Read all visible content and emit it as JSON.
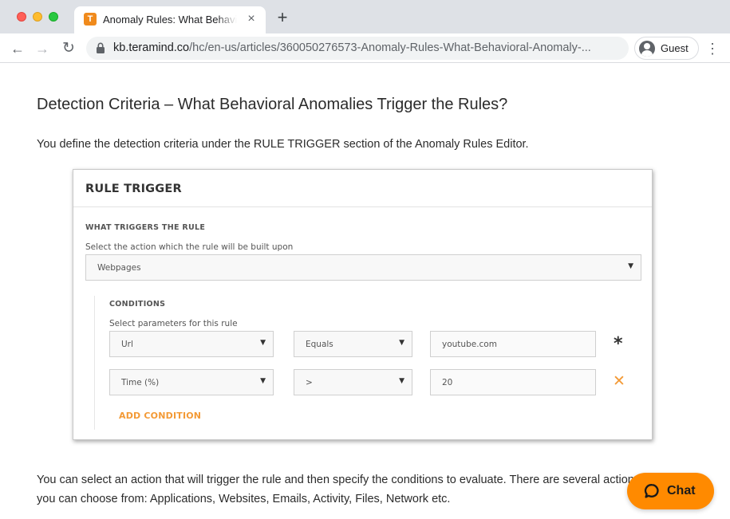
{
  "browser": {
    "tab": {
      "favicon_letter": "T",
      "title": "Anomaly Rules: What Behavioral Anomalies Trigger the Rules",
      "close_glyph": "×"
    },
    "new_tab_glyph": "+",
    "nav": {
      "back_glyph": "←",
      "forward_glyph": "→",
      "reload_glyph": "↻"
    },
    "address": {
      "host": "kb.teramind.co",
      "path": "/hc/en-us/articles/360050276573-Anomaly-Rules-What-Behavioral-Anomaly-..."
    },
    "profile_label": "Guest",
    "menu_glyph": "⋮"
  },
  "article": {
    "heading": "Detection Criteria – What Behavioral Anomalies Trigger the Rules?",
    "intro": "You define the detection criteria under the RULE TRIGGER section of the Anomaly Rules Editor.",
    "body": "You can select an action that will trigger the rule and then specify the conditions to evaluate. There are several actions you can choose from: Applications, Websites, Emails, Activity, Files, Network etc."
  },
  "rule_trigger": {
    "title": "RULE TRIGGER",
    "section_label": "WHAT TRIGGERS THE RULE",
    "select_hint": "Select the action which the rule will be built upon",
    "action_value": "Webpages",
    "conditions_label": "CONDITIONS",
    "conditions_hint": "Select parameters for this rule",
    "rows": [
      {
        "parameter": "Url",
        "operator": "Equals",
        "value": "youtube.com",
        "marker": "*"
      },
      {
        "parameter": "Time (%)",
        "operator": ">",
        "value": "20",
        "marker": "✕"
      }
    ],
    "add_condition": "ADD CONDITION",
    "caret_glyph": "▼"
  },
  "chat": {
    "label": "Chat"
  },
  "colors": {
    "accent": "#ff8a00",
    "link_orange": "#f39a36"
  }
}
